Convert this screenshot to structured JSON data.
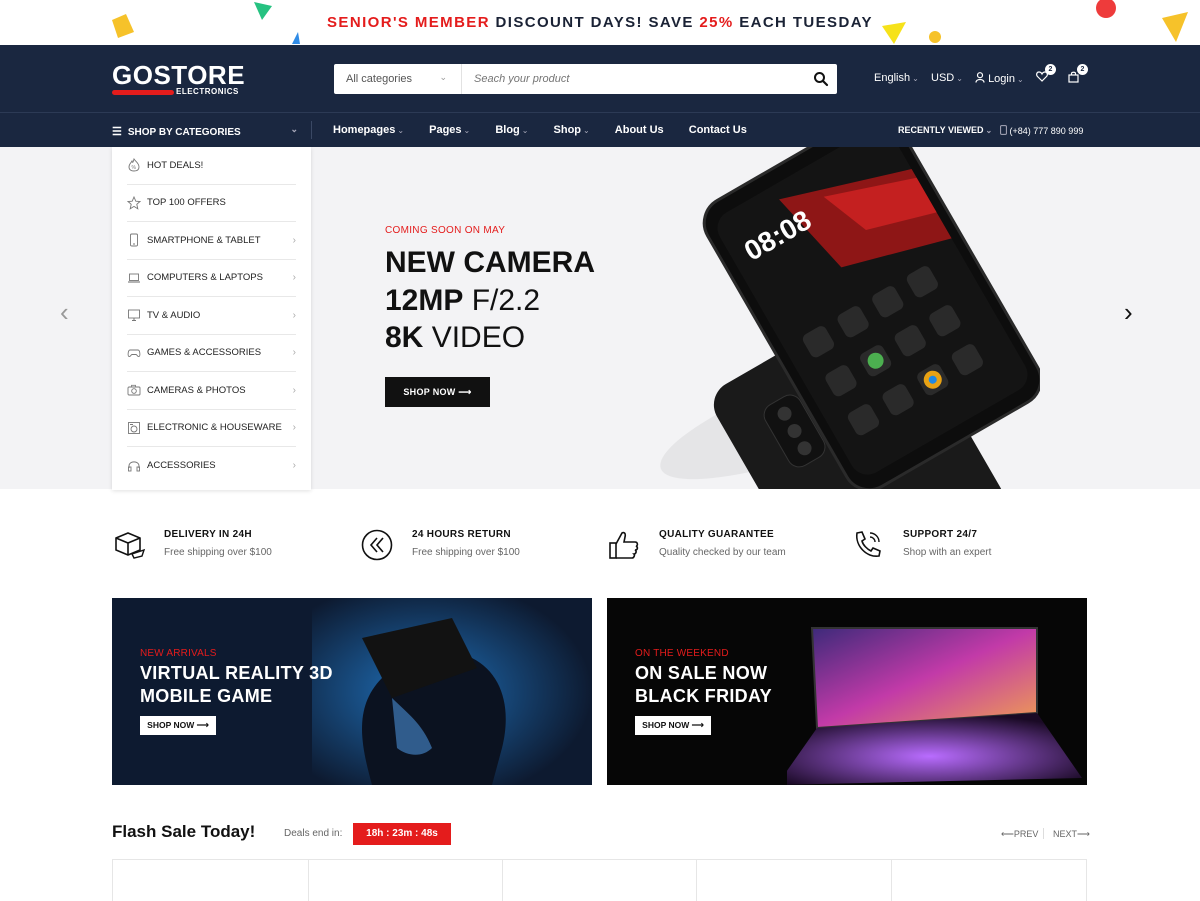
{
  "promo": {
    "part1": "SENIOR'S MEMBER",
    "part2": " DISCOUNT DAYS! SAVE ",
    "part3": "25%",
    "part4": " EACH TUESDAY"
  },
  "header": {
    "logo": "GOSTORE",
    "logo_sub": "ELECTRONICS",
    "search_category": "All categories",
    "search_placeholder": "Seach your product",
    "language": "English",
    "currency": "USD",
    "login": "Login",
    "wishlist_count": "2",
    "cart_count": "2"
  },
  "nav": {
    "categories_label": "SHOP BY CATEGORIES",
    "items": [
      "Homepages",
      "Pages",
      "Blog",
      "Shop",
      "About Us",
      "Contact Us"
    ],
    "recently_viewed": "RECENTLY VIEWED",
    "phone": "(+84) 777 890 999"
  },
  "categories": [
    {
      "label": "HOT DEALS!",
      "icon": "fire-percent-icon"
    },
    {
      "label": "TOP 100 OFFERS",
      "icon": "star-icon"
    },
    {
      "label": "SMARTPHONE & TABLET",
      "icon": "smartphone-icon"
    },
    {
      "label": "COMPUTERS & LAPTOPS",
      "icon": "laptop-icon"
    },
    {
      "label": "TV & AUDIO",
      "icon": "monitor-icon"
    },
    {
      "label": "GAMES & ACCESSORIES",
      "icon": "gamepad-icon"
    },
    {
      "label": "CAMERAS & PHOTOS",
      "icon": "camera-icon"
    },
    {
      "label": "ELECTRONIC & HOUSEWARE",
      "icon": "appliance-icon"
    },
    {
      "label": "ACCESSORIES",
      "icon": "headphones-icon"
    }
  ],
  "hero": {
    "eyebrow": "COMING SOON ON MAY",
    "line1": "NEW CAMERA",
    "line2_bold": "12MP",
    "line2_rest": " F/2.2",
    "line3_bold": "8K",
    "line3_rest": " VIDEO",
    "button": "SHOP NOW",
    "phone_screen_time": "08:08"
  },
  "features": [
    {
      "title": "DELIVERY IN 24H",
      "sub": "Free shipping over $100",
      "icon": "delivery-box-icon"
    },
    {
      "title": "24 HOURS RETURN",
      "sub": "Free shipping over $100",
      "icon": "return-icon"
    },
    {
      "title": "QUALITY GUARANTEE",
      "sub": "Quality checked by our team",
      "icon": "thumbs-up-icon"
    },
    {
      "title": "SUPPORT 24/7",
      "sub": "Shop with an expert",
      "icon": "phone-support-icon"
    }
  ],
  "banners": [
    {
      "eyebrow": "NEW ARRIVALS",
      "line1": "VIRTUAL REALITY 3D",
      "line2": "MOBILE GAME",
      "button": "SHOP NOW"
    },
    {
      "eyebrow": "ON THE WEEKEND",
      "line1": "ON SALE NOW",
      "line2": "BLACK FRIDAY",
      "button": "SHOP NOW"
    }
  ],
  "flash": {
    "title": "Flash Sale Today!",
    "deals_end": "Deals end in:",
    "timer": "18h : 23m : 48s",
    "prev": "PREV",
    "next": "NEXT"
  },
  "colors": {
    "accent": "#e41c1c",
    "navy": "#1a2740"
  }
}
